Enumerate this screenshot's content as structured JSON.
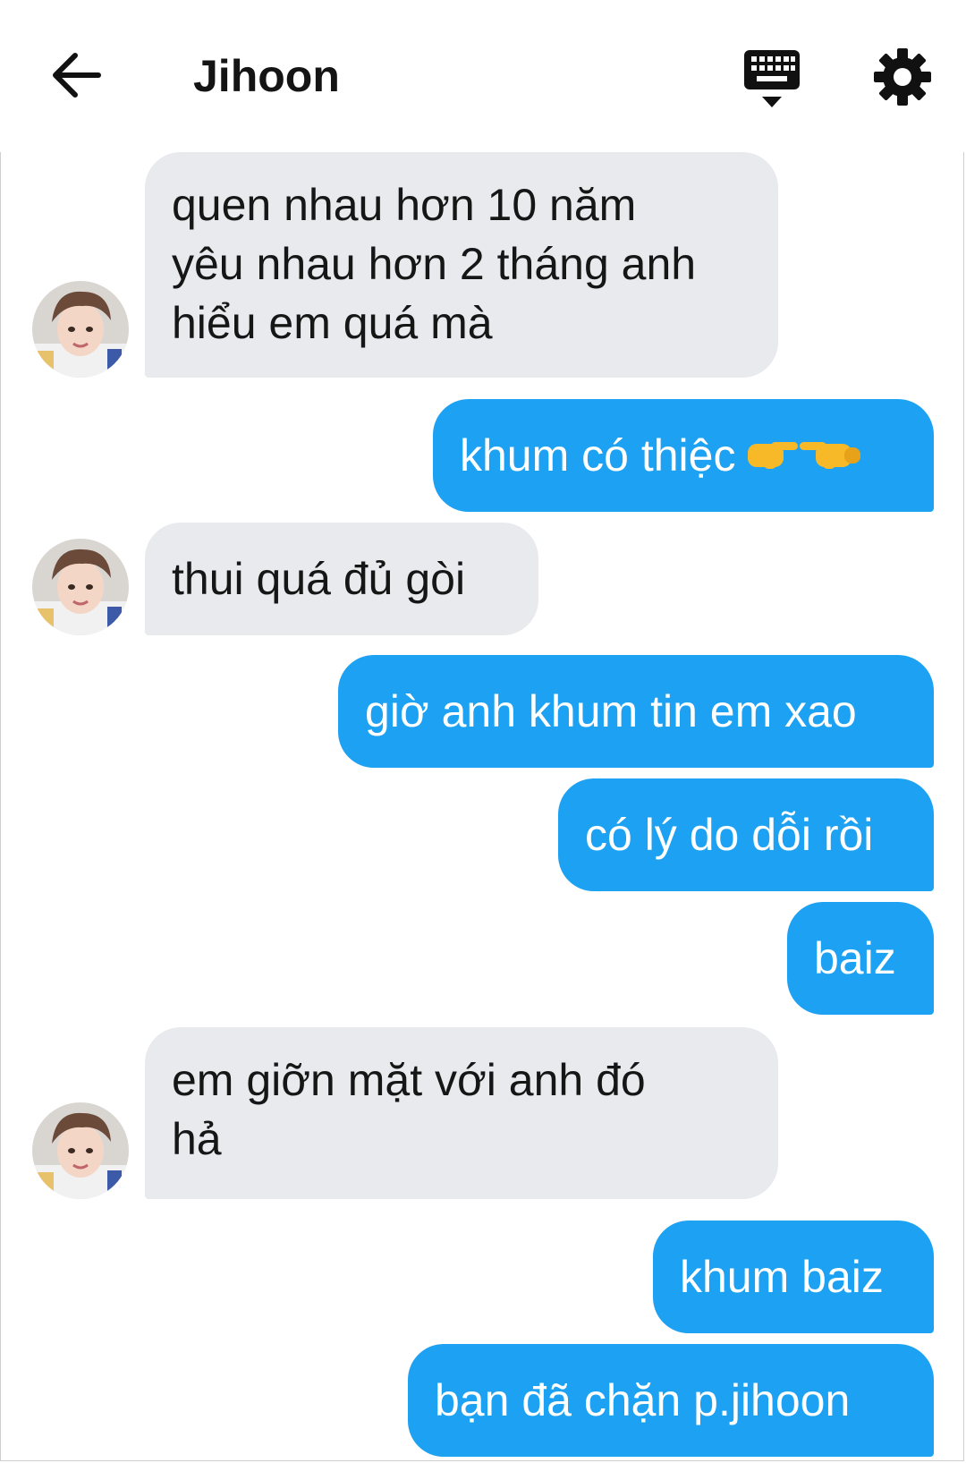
{
  "header": {
    "title": "Jihoon",
    "back_icon": "arrow-left-icon",
    "keyboard_icon": "keyboard-hide-icon",
    "settings_icon": "gear-icon"
  },
  "colors": {
    "sent_bubble": "#1da1f2",
    "received_bubble": "#e8eaed",
    "text_dark": "#161616"
  },
  "messages": [
    {
      "side": "received",
      "text": "quen nhau hơn 10 năm\nyêu nhau hơn 2 tháng anh\nhiểu em quá mà"
    },
    {
      "side": "sent",
      "text": "khum có thiệc",
      "emoji": "pointing-hands-icon"
    },
    {
      "side": "received",
      "text": "thui quá đủ gòi"
    },
    {
      "side": "sent",
      "text": "giờ anh khum tin em xao"
    },
    {
      "side": "sent",
      "text": "có lý do dỗi rồi"
    },
    {
      "side": "sent",
      "text": "baiz"
    },
    {
      "side": "received",
      "text": "em giỡn mặt với anh đó\nhả"
    },
    {
      "side": "sent",
      "text": "khum baiz"
    },
    {
      "side": "sent",
      "text": "bạn đã chặn p.jihoon"
    }
  ]
}
